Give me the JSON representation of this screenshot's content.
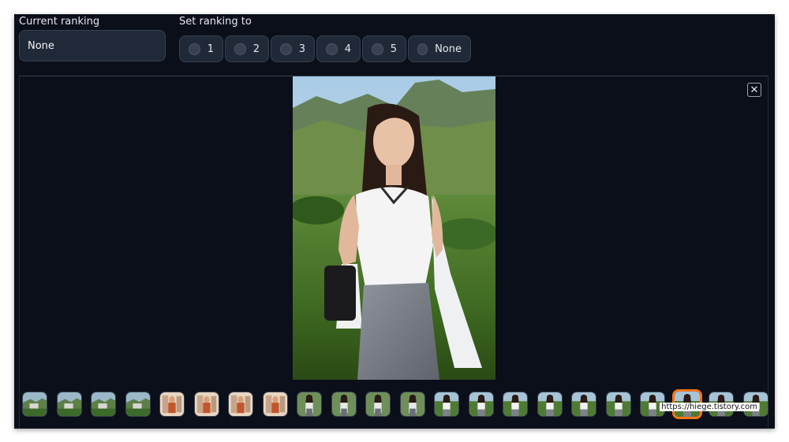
{
  "ranking": {
    "current_label": "Current ranking",
    "current_value": "None",
    "set_label": "Set ranking to",
    "options": [
      "1",
      "2",
      "3",
      "4",
      "5",
      "None"
    ]
  },
  "viewer": {
    "close_glyph": "✕",
    "thumbnail_count": 22,
    "selected_thumbnail_index": 19
  },
  "watermark": "https://hiege.tistory.com"
}
